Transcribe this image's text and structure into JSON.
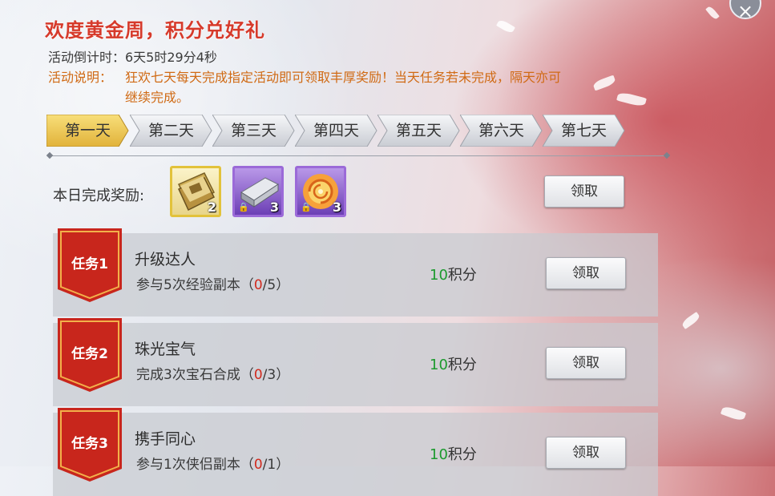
{
  "header": {
    "title": "欢度黄金周，积分兑好礼",
    "countdown": "活动倒计时：6天5时29分4秒",
    "desc_label": "活动说明：",
    "desc_body": "狂欢七天每天完成指定活动即可领取丰厚奖励！当天任务若未完成，隔天亦可继续完成。"
  },
  "close_icon": "×",
  "tabs": [
    "第一天",
    "第二天",
    "第三天",
    "第四天",
    "第五天",
    "第六天",
    "第七天"
  ],
  "active_tab": 0,
  "daily_reward": {
    "label": "本日完成奖励:",
    "items": [
      {
        "icon": "scroll-book-icon",
        "count": "2",
        "locked": false
      },
      {
        "icon": "silver-ingot-icon",
        "count": "3",
        "locked": true
      },
      {
        "icon": "golden-swirl-icon",
        "count": "3",
        "locked": true
      }
    ],
    "claim_label": "领取"
  },
  "tasks": [
    {
      "badge": "任务1",
      "name": "升级达人",
      "desc_pre": "参与5次经验副本（",
      "progress": "0",
      "desc_post": "/5）",
      "points_num": "10",
      "points_unit": "积分",
      "claim_label": "领取"
    },
    {
      "badge": "任务2",
      "name": "珠光宝气",
      "desc_pre": "完成3次宝石合成（",
      "progress": "0",
      "desc_post": "/3）",
      "points_num": "10",
      "points_unit": "积分",
      "claim_label": "领取"
    },
    {
      "badge": "任务3",
      "name": "携手同心",
      "desc_pre": "参与1次侠侣副本（",
      "progress": "0",
      "desc_post": "/1）",
      "points_num": "10",
      "points_unit": "积分",
      "claim_label": "领取"
    }
  ],
  "colors": {
    "title": "#d63a2b",
    "desc": "#d06a14",
    "points": "#1c9a2e",
    "progress": "#d22a1d",
    "ribbon": "#c8261c",
    "tab_active": "#f0cb52"
  }
}
